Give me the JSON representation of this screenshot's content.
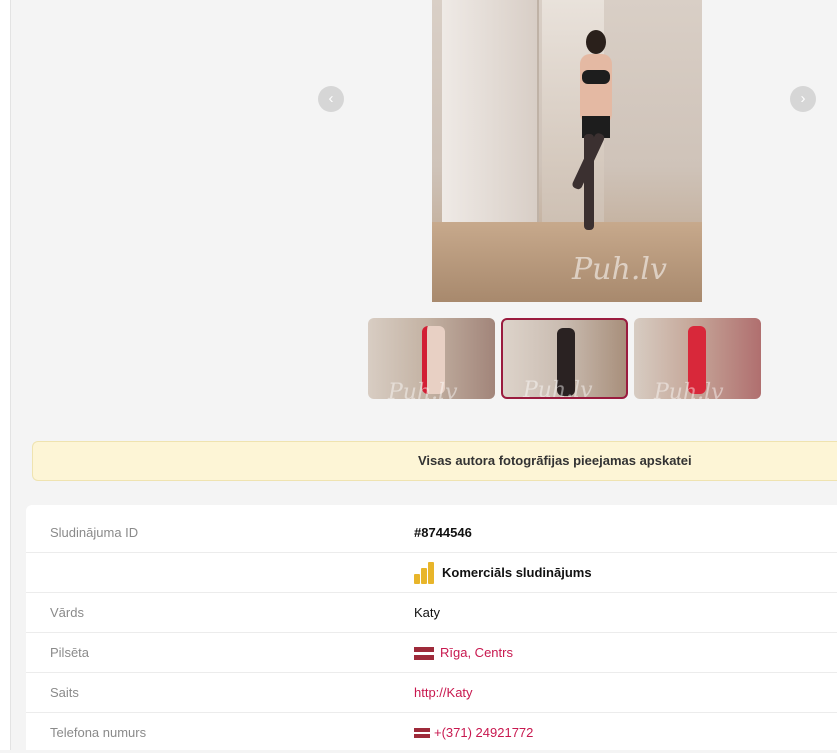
{
  "gallery": {
    "watermark": "Puh.lv",
    "prev_icon": "chevron-left",
    "next_icon": "chevron-right",
    "thumbnails": [
      {
        "watermark": "Puh.lv",
        "selected": false
      },
      {
        "watermark": "Puh.lv",
        "selected": true
      },
      {
        "watermark": "Puh.lv",
        "selected": false
      }
    ]
  },
  "notice": {
    "text": "Visas autora fotogrāfijas pieejamas apskatei"
  },
  "details": {
    "ad_id": {
      "label": "Sludinājuma ID",
      "value": "#8744546"
    },
    "commercial": {
      "label": "",
      "value": "Komerciāls sludinājums",
      "icon": "coins-icon"
    },
    "name": {
      "label": "Vārds",
      "value": "Katy"
    },
    "city": {
      "label": "Pilsēta",
      "value": "Rīga, Centrs",
      "icon": "latvia-flag-icon"
    },
    "site": {
      "label": "Saits",
      "value": "http://Katy"
    },
    "phone": {
      "label": "Telefona numurs",
      "value": "+(371) 24921772",
      "icon": "latvia-flag-icon"
    }
  },
  "colors": {
    "accent": "#c8184f",
    "selected_border": "#9a1b3e",
    "notice_bg": "#fdf5d6"
  }
}
